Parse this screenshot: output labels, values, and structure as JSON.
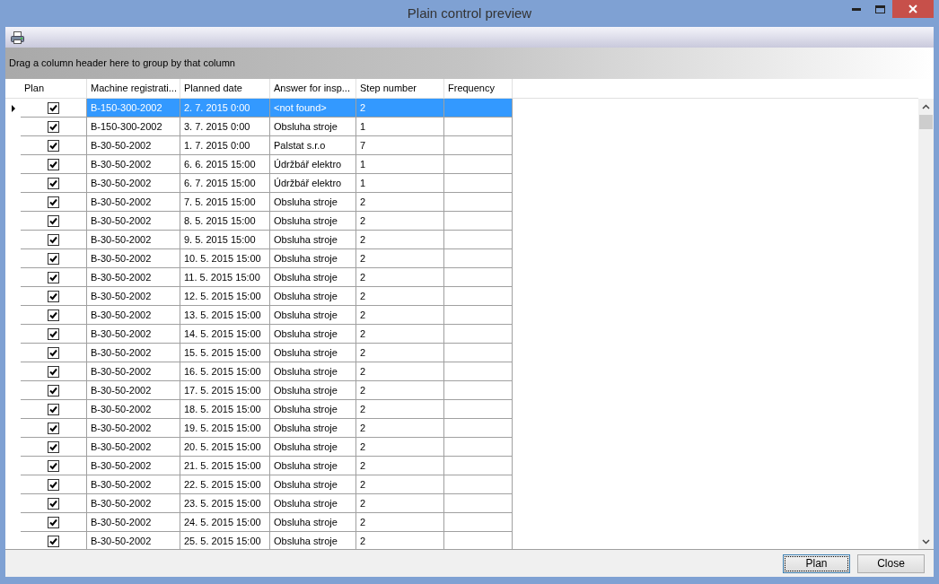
{
  "window": {
    "title": "Plain control preview"
  },
  "group_panel": {
    "text": "Drag a column header here to group by that column"
  },
  "table": {
    "check_column": "Plan",
    "columns": [
      "Machine registrati...",
      "Planned date",
      "Answer for insp...",
      "Step number",
      "Frequency"
    ],
    "rows": [
      {
        "checked": true,
        "selected": true,
        "cells": [
          "B-150-300-2002",
          "2. 7. 2015 0:00",
          "<not found>",
          "2"
        ]
      },
      {
        "checked": true,
        "selected": false,
        "cells": [
          "B-150-300-2002",
          "3. 7. 2015 0:00",
          "Obsluha stroje",
          "1"
        ]
      },
      {
        "checked": true,
        "selected": false,
        "cells": [
          "B-30-50-2002",
          "1. 7. 2015 0:00",
          "Palstat s.r.o",
          "7"
        ]
      },
      {
        "checked": true,
        "selected": false,
        "cells": [
          "B-30-50-2002",
          "6. 6. 2015 15:00",
          "Údržbář elektro",
          "1"
        ]
      },
      {
        "checked": true,
        "selected": false,
        "cells": [
          "B-30-50-2002",
          "6. 7. 2015 15:00",
          "Údržbář elektro",
          "1"
        ]
      },
      {
        "checked": true,
        "selected": false,
        "cells": [
          "B-30-50-2002",
          "7. 5. 2015 15:00",
          "Obsluha stroje",
          "2"
        ]
      },
      {
        "checked": true,
        "selected": false,
        "cells": [
          "B-30-50-2002",
          "8. 5. 2015 15:00",
          "Obsluha stroje",
          "2"
        ]
      },
      {
        "checked": true,
        "selected": false,
        "cells": [
          "B-30-50-2002",
          "9. 5. 2015 15:00",
          "Obsluha stroje",
          "2"
        ]
      },
      {
        "checked": true,
        "selected": false,
        "cells": [
          "B-30-50-2002",
          "10. 5. 2015 15:00",
          "Obsluha stroje",
          "2"
        ]
      },
      {
        "checked": true,
        "selected": false,
        "cells": [
          "B-30-50-2002",
          "11. 5. 2015 15:00",
          "Obsluha stroje",
          "2"
        ]
      },
      {
        "checked": true,
        "selected": false,
        "cells": [
          "B-30-50-2002",
          "12. 5. 2015 15:00",
          "Obsluha stroje",
          "2"
        ]
      },
      {
        "checked": true,
        "selected": false,
        "cells": [
          "B-30-50-2002",
          "13. 5. 2015 15:00",
          "Obsluha stroje",
          "2"
        ]
      },
      {
        "checked": true,
        "selected": false,
        "cells": [
          "B-30-50-2002",
          "14. 5. 2015 15:00",
          "Obsluha stroje",
          "2"
        ]
      },
      {
        "checked": true,
        "selected": false,
        "cells": [
          "B-30-50-2002",
          "15. 5. 2015 15:00",
          "Obsluha stroje",
          "2"
        ]
      },
      {
        "checked": true,
        "selected": false,
        "cells": [
          "B-30-50-2002",
          "16. 5. 2015 15:00",
          "Obsluha stroje",
          "2"
        ]
      },
      {
        "checked": true,
        "selected": false,
        "cells": [
          "B-30-50-2002",
          "17. 5. 2015 15:00",
          "Obsluha stroje",
          "2"
        ]
      },
      {
        "checked": true,
        "selected": false,
        "cells": [
          "B-30-50-2002",
          "18. 5. 2015 15:00",
          "Obsluha stroje",
          "2"
        ]
      },
      {
        "checked": true,
        "selected": false,
        "cells": [
          "B-30-50-2002",
          "19. 5. 2015 15:00",
          "Obsluha stroje",
          "2"
        ]
      },
      {
        "checked": true,
        "selected": false,
        "cells": [
          "B-30-50-2002",
          "20. 5. 2015 15:00",
          "Obsluha stroje",
          "2"
        ]
      },
      {
        "checked": true,
        "selected": false,
        "cells": [
          "B-30-50-2002",
          "21. 5. 2015 15:00",
          "Obsluha stroje",
          "2"
        ]
      },
      {
        "checked": true,
        "selected": false,
        "cells": [
          "B-30-50-2002",
          "22. 5. 2015 15:00",
          "Obsluha stroje",
          "2"
        ]
      },
      {
        "checked": true,
        "selected": false,
        "cells": [
          "B-30-50-2002",
          "23. 5. 2015 15:00",
          "Obsluha stroje",
          "2"
        ]
      },
      {
        "checked": true,
        "selected": false,
        "cells": [
          "B-30-50-2002",
          "24. 5. 2015 15:00",
          "Obsluha stroje",
          "2"
        ]
      },
      {
        "checked": true,
        "selected": false,
        "cells": [
          "B-30-50-2002",
          "25. 5. 2015 15:00",
          "Obsluha stroje",
          "2"
        ]
      }
    ]
  },
  "buttons": [
    {
      "label": "Plan",
      "focused": true
    },
    {
      "label": "Close",
      "focused": false
    }
  ]
}
